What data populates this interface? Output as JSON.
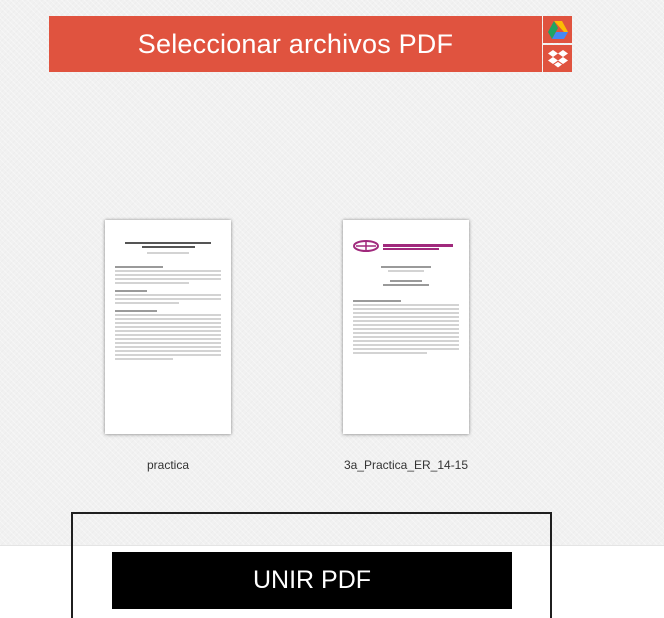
{
  "toolbar": {
    "select_files_label": "Seleccionar archivos PDF",
    "google_drive_icon": "google-drive-icon",
    "dropbox_icon": "dropbox-icon",
    "accent_color": "#e0533f"
  },
  "files": [
    {
      "name": "practica"
    },
    {
      "name": "3a_Practica_ER_14-15"
    }
  ],
  "actions": {
    "merge_label": "UNIR PDF"
  }
}
